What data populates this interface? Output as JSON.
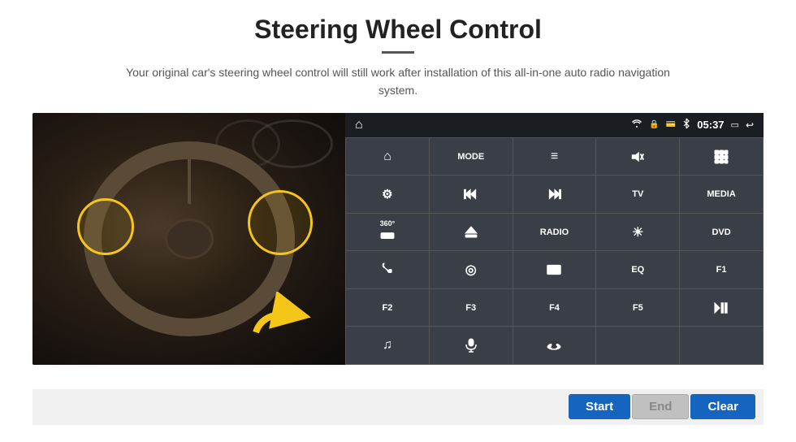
{
  "header": {
    "title": "Steering Wheel Control",
    "subtitle": "Your original car's steering wheel control will still work after installation of this all-in-one auto radio navigation system."
  },
  "statusBar": {
    "time": "05:37",
    "icons": [
      "wifi",
      "lock",
      "card",
      "bluetooth",
      "rect",
      "back"
    ]
  },
  "buttons": [
    {
      "id": "home",
      "type": "icon",
      "icon": "home",
      "label": ""
    },
    {
      "id": "mode",
      "type": "text",
      "label": "MODE"
    },
    {
      "id": "list",
      "type": "icon",
      "icon": "list",
      "label": ""
    },
    {
      "id": "mute",
      "type": "icon",
      "icon": "mute",
      "label": ""
    },
    {
      "id": "apps",
      "type": "icon",
      "icon": "dots",
      "label": ""
    },
    {
      "id": "settings",
      "type": "icon",
      "icon": "settings",
      "label": ""
    },
    {
      "id": "prev",
      "type": "icon",
      "icon": "prev",
      "label": ""
    },
    {
      "id": "next",
      "type": "icon",
      "icon": "next",
      "label": ""
    },
    {
      "id": "tv",
      "type": "text",
      "label": "TV"
    },
    {
      "id": "media",
      "type": "text",
      "label": "MEDIA"
    },
    {
      "id": "cam360",
      "type": "icon",
      "icon": "360",
      "label": ""
    },
    {
      "id": "eject",
      "type": "icon",
      "icon": "eject",
      "label": ""
    },
    {
      "id": "radio",
      "type": "text",
      "label": "RADIO"
    },
    {
      "id": "brightness",
      "type": "icon",
      "icon": "sun",
      "label": ""
    },
    {
      "id": "dvd",
      "type": "text",
      "label": "DVD"
    },
    {
      "id": "phone",
      "type": "icon",
      "icon": "phone",
      "label": ""
    },
    {
      "id": "globe",
      "type": "icon",
      "icon": "globe",
      "label": ""
    },
    {
      "id": "rect",
      "type": "icon",
      "icon": "rect",
      "label": ""
    },
    {
      "id": "eq",
      "type": "text",
      "label": "EQ"
    },
    {
      "id": "f1",
      "type": "text",
      "label": "F1"
    },
    {
      "id": "f2",
      "type": "text",
      "label": "F2"
    },
    {
      "id": "f3",
      "type": "text",
      "label": "F3"
    },
    {
      "id": "f4",
      "type": "text",
      "label": "F4"
    },
    {
      "id": "f5",
      "type": "text",
      "label": "F5"
    },
    {
      "id": "playpause",
      "type": "icon",
      "icon": "playpause",
      "label": ""
    },
    {
      "id": "note",
      "type": "icon",
      "icon": "note",
      "label": ""
    },
    {
      "id": "mic",
      "type": "icon",
      "icon": "mic",
      "label": ""
    },
    {
      "id": "callend",
      "type": "icon",
      "icon": "callend",
      "label": ""
    },
    {
      "id": "empty1",
      "type": "empty",
      "label": ""
    },
    {
      "id": "empty2",
      "type": "empty",
      "label": ""
    }
  ],
  "bottomButtons": {
    "start": "Start",
    "end": "End",
    "clear": "Clear"
  }
}
